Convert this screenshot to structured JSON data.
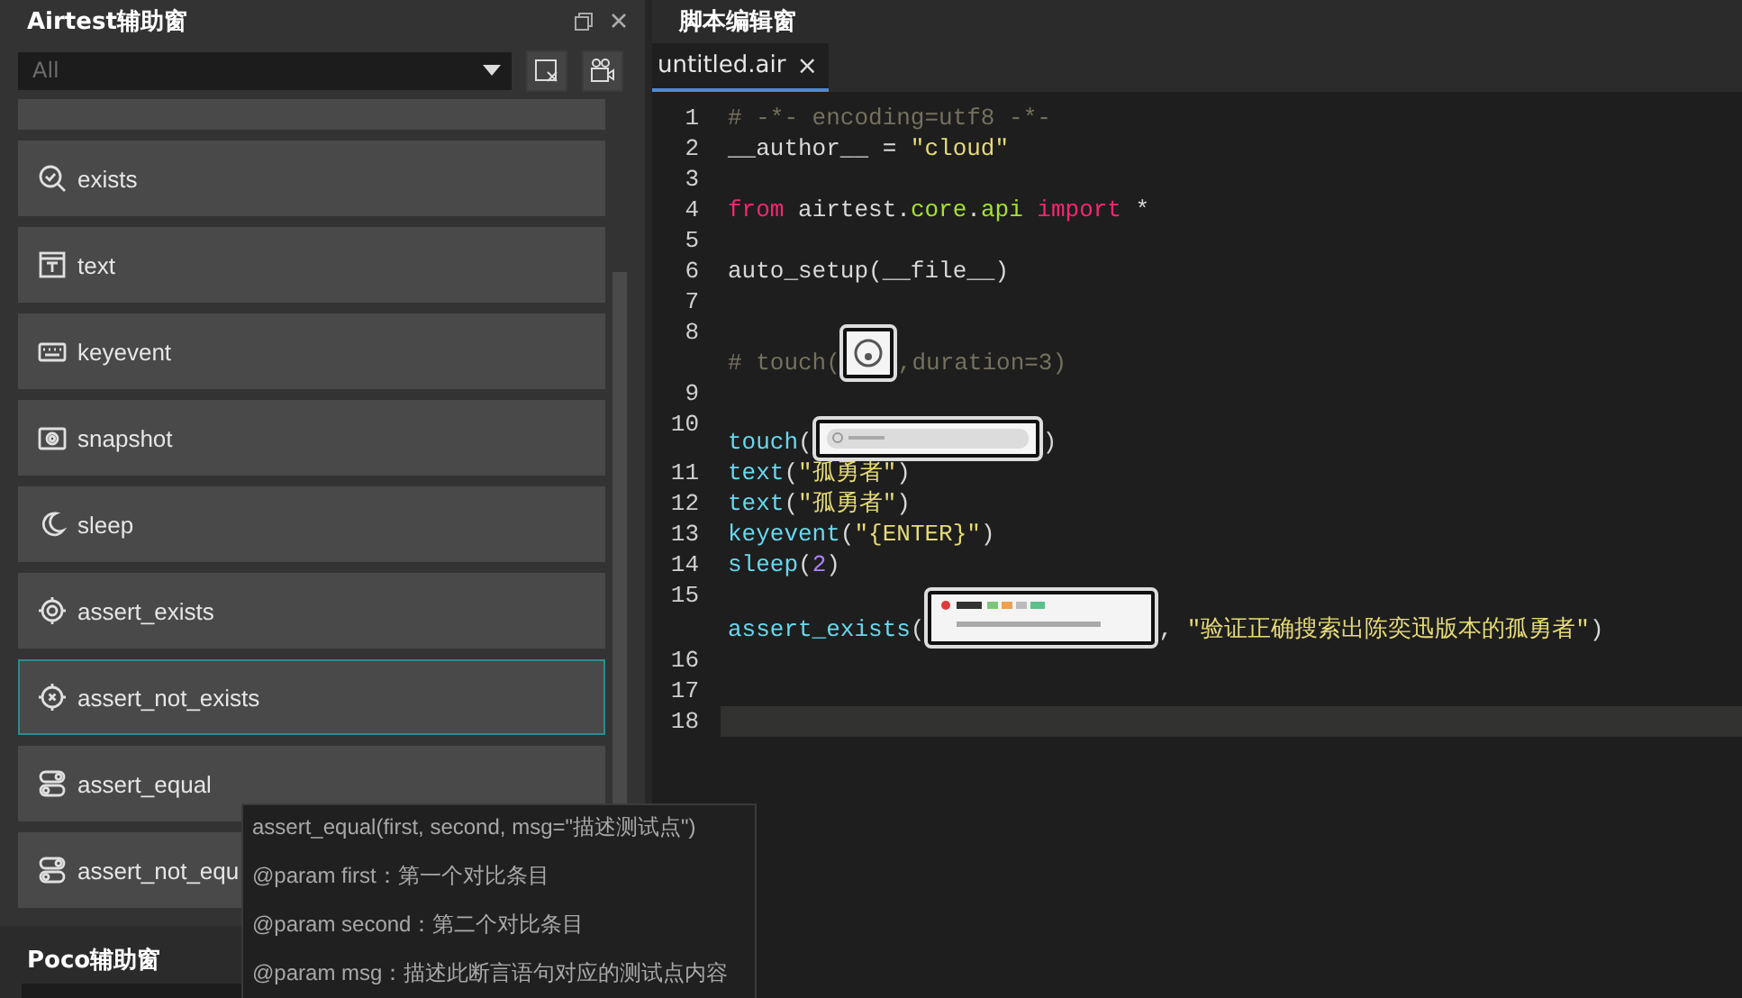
{
  "airtest_panel": {
    "title": "Airtest辅助窗",
    "filter": {
      "value": "All"
    },
    "items": [
      {
        "label": "exists",
        "selected": false
      },
      {
        "label": "text",
        "selected": false
      },
      {
        "label": "keyevent",
        "selected": false
      },
      {
        "label": "snapshot",
        "selected": false
      },
      {
        "label": "sleep",
        "selected": false
      },
      {
        "label": "assert_exists",
        "selected": false
      },
      {
        "label": "assert_not_exists",
        "selected": true
      },
      {
        "label": "assert_equal",
        "selected": false
      },
      {
        "label": "assert_not_equ",
        "selected": false
      }
    ],
    "tooltip": [
      "assert_equal(first, second, msg=\"描述测试点\")",
      "@param first：第一个对比条目",
      "@param second：第二个对比条目",
      "@param msg：描述此断言语句对应的测试点内容"
    ]
  },
  "poco_panel": {
    "title": "Poco辅助窗"
  },
  "editor": {
    "title": "脚本编辑窗",
    "tabs": [
      {
        "label": "untitled.air",
        "close": "×",
        "selected": true
      }
    ],
    "lines": [
      {
        "number": "1",
        "current": false,
        "tokens": [
          {
            "kind": "comment",
            "text": "# -*- encoding=utf8 -*-"
          }
        ]
      },
      {
        "number": "2",
        "current": false,
        "tokens": [
          {
            "kind": "plain",
            "text": "__author__ = "
          },
          {
            "kind": "string",
            "text": "\"cloud\""
          }
        ]
      },
      {
        "number": "3",
        "current": false
      },
      {
        "number": "4",
        "current": false,
        "tokens": [
          {
            "kind": "keyword",
            "text": "from"
          },
          {
            "kind": "plain",
            "text": " airtest."
          },
          {
            "kind": "module",
            "text": "core"
          },
          {
            "kind": "plain",
            "text": "."
          },
          {
            "kind": "module",
            "text": "api"
          },
          {
            "kind": "keyword",
            "text": " import"
          },
          {
            "kind": "plain",
            "text": " *"
          }
        ]
      },
      {
        "number": "5",
        "current": false
      },
      {
        "number": "6",
        "current": false,
        "tokens": [
          {
            "kind": "plain",
            "text": "auto_setup(__file__)"
          }
        ]
      },
      {
        "number": "7",
        "current": false
      },
      {
        "number": "8",
        "current": false,
        "tokens": [
          {
            "kind": "comment",
            "text": "# touch("
          },
          {
            "kind": "picture"
          },
          {
            "kind": "comment",
            "text": ",duration=3)"
          }
        ]
      },
      {
        "number": "9",
        "current": false
      },
      {
        "number": "10",
        "current": false,
        "tokens": [
          {
            "kind": "func",
            "text": "touch"
          },
          {
            "kind": "plain",
            "text": "("
          },
          {
            "kind": "picture"
          },
          {
            "kind": "plain",
            "text": ")"
          }
        ]
      },
      {
        "number": "11",
        "current": false,
        "tokens": [
          {
            "kind": "func",
            "text": "text"
          },
          {
            "kind": "plain",
            "text": "("
          },
          {
            "kind": "string",
            "text": "\"孤勇者\""
          },
          {
            "kind": "plain",
            "text": ")"
          }
        ]
      },
      {
        "number": "12",
        "current": false,
        "tokens": [
          {
            "kind": "func",
            "text": "text"
          },
          {
            "kind": "plain",
            "text": "("
          },
          {
            "kind": "string",
            "text": "\"孤勇者\""
          },
          {
            "kind": "plain",
            "text": ")"
          }
        ]
      },
      {
        "number": "13",
        "current": false,
        "tokens": [
          {
            "kind": "func",
            "text": "keyevent"
          },
          {
            "kind": "plain",
            "text": "("
          },
          {
            "kind": "string",
            "text": "\"{ENTER}\""
          },
          {
            "kind": "plain",
            "text": ")"
          }
        ]
      },
      {
        "number": "14",
        "current": false,
        "tokens": [
          {
            "kind": "func",
            "text": "sleep"
          },
          {
            "kind": "plain",
            "text": "("
          },
          {
            "kind": "number",
            "text": "2"
          },
          {
            "kind": "plain",
            "text": ")"
          }
        ]
      },
      {
        "number": "15",
        "current": false,
        "tokens": [
          {
            "kind": "func",
            "text": "assert_exists"
          },
          {
            "kind": "plain",
            "text": "("
          },
          {
            "kind": "picture"
          },
          {
            "kind": "plain",
            "text": ", "
          },
          {
            "kind": "string",
            "text": "\"验证正确搜索出陈奕迅版本的孤勇者\""
          },
          {
            "kind": "plain",
            "text": ")"
          }
        ]
      },
      {
        "number": "16",
        "current": false
      },
      {
        "number": "17",
        "current": false
      },
      {
        "number": "18",
        "current": true
      }
    ]
  }
}
